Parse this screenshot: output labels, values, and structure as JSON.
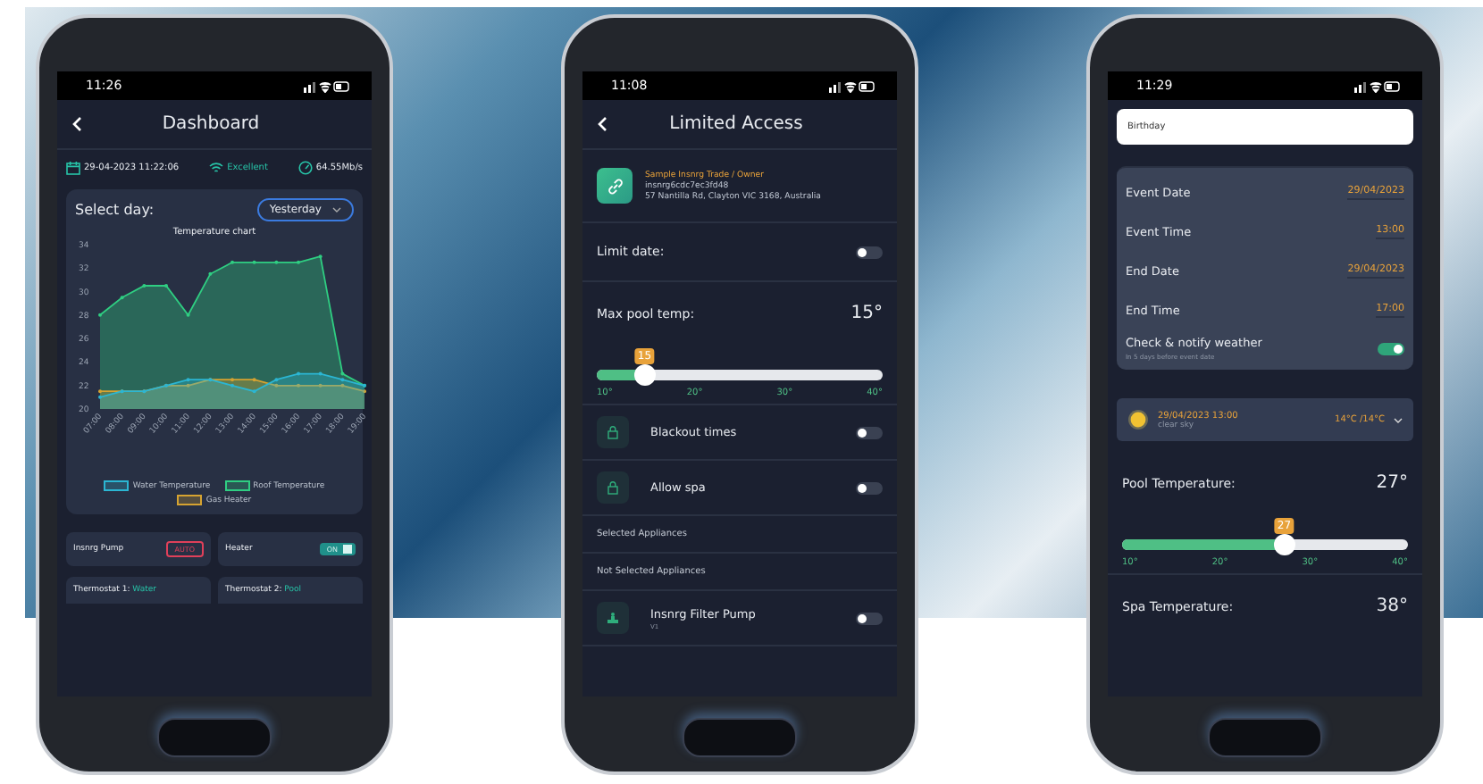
{
  "dashboard_screen": {
    "status_time": "11:26",
    "title": "Dashboard",
    "info": {
      "datetime": "29-04-2023 11:22:06",
      "wifi": "Excellent",
      "speed": "64.55Mb/s"
    },
    "select_day": {
      "label": "Select day:",
      "value": "Yesterday"
    },
    "chart_data": {
      "type": "area",
      "title": "Temperature chart",
      "categories": [
        "07:00",
        "08:00",
        "09:00",
        "10:00",
        "11:00",
        "12:00",
        "13:00",
        "14:00",
        "15:00",
        "16:00",
        "17:00",
        "18:00",
        "19:00"
      ],
      "ylim": [
        20,
        34
      ],
      "yticks": [
        20,
        22,
        24,
        26,
        28,
        30,
        32,
        34
      ],
      "series": [
        {
          "name": "Roof Temperature",
          "color": "#2fce82",
          "values": [
            28,
            29.5,
            30.5,
            30.5,
            28,
            31.5,
            32.5,
            32.5,
            32.5,
            32.5,
            33,
            23,
            22
          ]
        },
        {
          "name": "Gas Heater",
          "color": "#d6a331",
          "values": [
            21.5,
            21.5,
            21.5,
            22,
            22,
            22.5,
            22.5,
            22.5,
            22,
            22,
            22,
            22,
            21.5
          ]
        },
        {
          "name": "Water Temperature",
          "color": "#2bb6d3",
          "values": [
            21,
            21.5,
            21.5,
            22,
            22.5,
            22.5,
            22,
            21.5,
            22.5,
            23,
            23,
            22.5,
            22
          ]
        }
      ]
    },
    "tiles": [
      {
        "kind": "badge",
        "label": "Insnrg Pump",
        "badge": "AUTO"
      },
      {
        "kind": "toggle",
        "label": "Heater",
        "toggle_text": "ON",
        "on": true
      }
    ],
    "thermostats": [
      {
        "label": "Thermostat 1:",
        "mode": "Water"
      },
      {
        "label": "Thermostat 2:",
        "mode": "Pool"
      }
    ]
  },
  "limited_access_screen": {
    "status_time": "11:08",
    "title": "Limited Access",
    "owner": {
      "role": "Sample Insnrg Trade / Owner",
      "id": "insnrg6cdc7ec3fd48",
      "address": "57 Nantilla Rd, Clayton VIC 3168, Australia"
    },
    "limit_date": {
      "label": "Limit date:",
      "on": false
    },
    "max_pool_temp": {
      "label": "Max pool temp:",
      "value": "15°",
      "bubble": "15",
      "level": 0.167,
      "ticks": [
        "10°",
        "20°",
        "30°",
        "40°"
      ]
    },
    "options": [
      {
        "label": "Blackout times",
        "on": false
      },
      {
        "label": "Allow spa",
        "on": false
      }
    ],
    "sections": [
      "Selected Appliances",
      "Not Selected Appliances"
    ],
    "appliances": [
      {
        "name": "Insnrg Filter Pump",
        "sub": "V1",
        "on": false
      }
    ]
  },
  "event_screen": {
    "status_time": "11:29",
    "event_name": "Birthday",
    "fields": [
      {
        "label": "Event Date",
        "value": "29/04/2023"
      },
      {
        "label": "Event Time",
        "value": "13:00"
      },
      {
        "label": "End Date",
        "value": "29/04/2023"
      },
      {
        "label": "End Time",
        "value": "17:00"
      }
    ],
    "notify": {
      "label": "Check & notify weather",
      "hint": "In 5 days before event date",
      "on": true
    },
    "weather": {
      "datetime": "29/04/2023 13:00",
      "condition": "clear sky",
      "temps": "14°C /14°C"
    },
    "pool_temp": {
      "label": "Pool Temperature:",
      "value": "27°",
      "bubble": "27",
      "level": 0.567,
      "ticks": [
        "10°",
        "20°",
        "30°",
        "40°"
      ]
    },
    "spa_temp": {
      "label": "Spa Temperature:",
      "value": "38°"
    }
  }
}
